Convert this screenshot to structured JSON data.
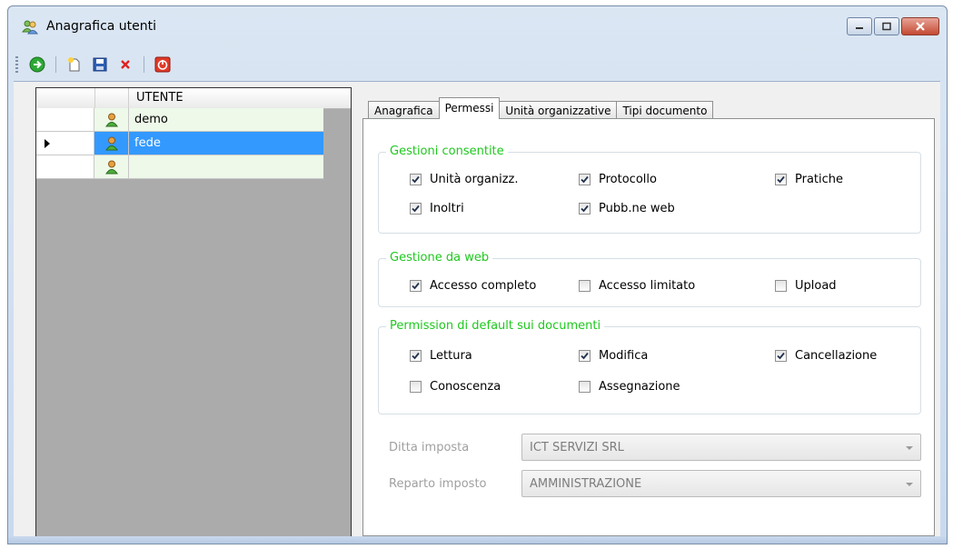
{
  "window": {
    "title": "Anagrafica utenti"
  },
  "toolbar": {
    "buttons": [
      "go-icon",
      "new-icon",
      "save-icon",
      "delete-icon",
      "close-form-icon"
    ]
  },
  "grid": {
    "header": "UTENTE",
    "rows": [
      {
        "name": "demo",
        "selected": false
      },
      {
        "name": "fede",
        "selected": true
      },
      {
        "name": "",
        "selected": false
      }
    ]
  },
  "tabs": [
    "Anagrafica",
    "Permessi",
    "Unità organizzative",
    "Tipi documento"
  ],
  "active_tab": "Permessi",
  "groups": {
    "gestioni": {
      "title": "Gestioni consentite",
      "items": [
        {
          "label": "Unità organizz.",
          "checked": true
        },
        {
          "label": "Protocollo",
          "checked": true
        },
        {
          "label": "Pratiche",
          "checked": true
        },
        {
          "label": "Inoltri",
          "checked": true
        },
        {
          "label": "Pubb.ne web",
          "checked": true
        }
      ]
    },
    "web": {
      "title": "Gestione da web",
      "items": [
        {
          "label": "Accesso completo",
          "checked": true
        },
        {
          "label": "Accesso limitato",
          "checked": false
        },
        {
          "label": "Upload",
          "checked": false
        }
      ]
    },
    "permission": {
      "title": "Permission di default sui documenti",
      "items": [
        {
          "label": "Lettura",
          "checked": true
        },
        {
          "label": "Modifica",
          "checked": true
        },
        {
          "label": "Cancellazione",
          "checked": true
        },
        {
          "label": "Conoscenza",
          "checked": false
        },
        {
          "label": "Assegnazione",
          "checked": false
        }
      ]
    }
  },
  "fields": {
    "ditta": {
      "label": "Ditta imposta",
      "value": "ICT SERVIZI SRL"
    },
    "reparto": {
      "label": "Reparto imposto",
      "value": "AMMINISTRAZIONE"
    }
  },
  "colors": {
    "accent_green": "#1ec81e",
    "selection_blue": "#3399ff",
    "row_green": "#eef9e9"
  }
}
